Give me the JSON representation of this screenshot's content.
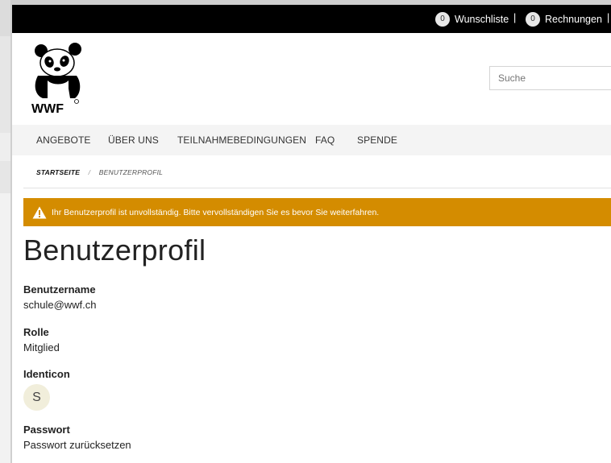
{
  "topbar": {
    "wishlist_count": "0",
    "wishlist_label": "Wunschliste",
    "separator": "|",
    "invoices_count": "0",
    "invoices_label": "Rechnungen"
  },
  "logo": {
    "text": "WWF"
  },
  "search": {
    "placeholder": "Suche"
  },
  "nav": {
    "items": [
      {
        "label": "ANGEBOTE"
      },
      {
        "label": "ÜBER UNS"
      },
      {
        "label": "TEILNAHMEBEDINGUNGEN"
      },
      {
        "label": "FAQ"
      },
      {
        "label": "SPENDE"
      }
    ]
  },
  "breadcrumb": {
    "home": "STARTSEITE",
    "separator": "/",
    "current": "BENUTZERPROFIL"
  },
  "alert": {
    "message": "Ihr Benutzerprofil ist unvollständig. Bitte vervollständigen Sie es bevor Sie weiterfahren.",
    "color": "#d48c00"
  },
  "page": {
    "title": "Benutzerprofil"
  },
  "profile": {
    "username_label": "Benutzername",
    "username_value": "schule@wwf.ch",
    "role_label": "Rolle",
    "role_value": "Mitglied",
    "identicon_label": "Identicon",
    "identicon_letter": "S",
    "password_label": "Passwort",
    "password_link": "Passwort zurücksetzen"
  }
}
